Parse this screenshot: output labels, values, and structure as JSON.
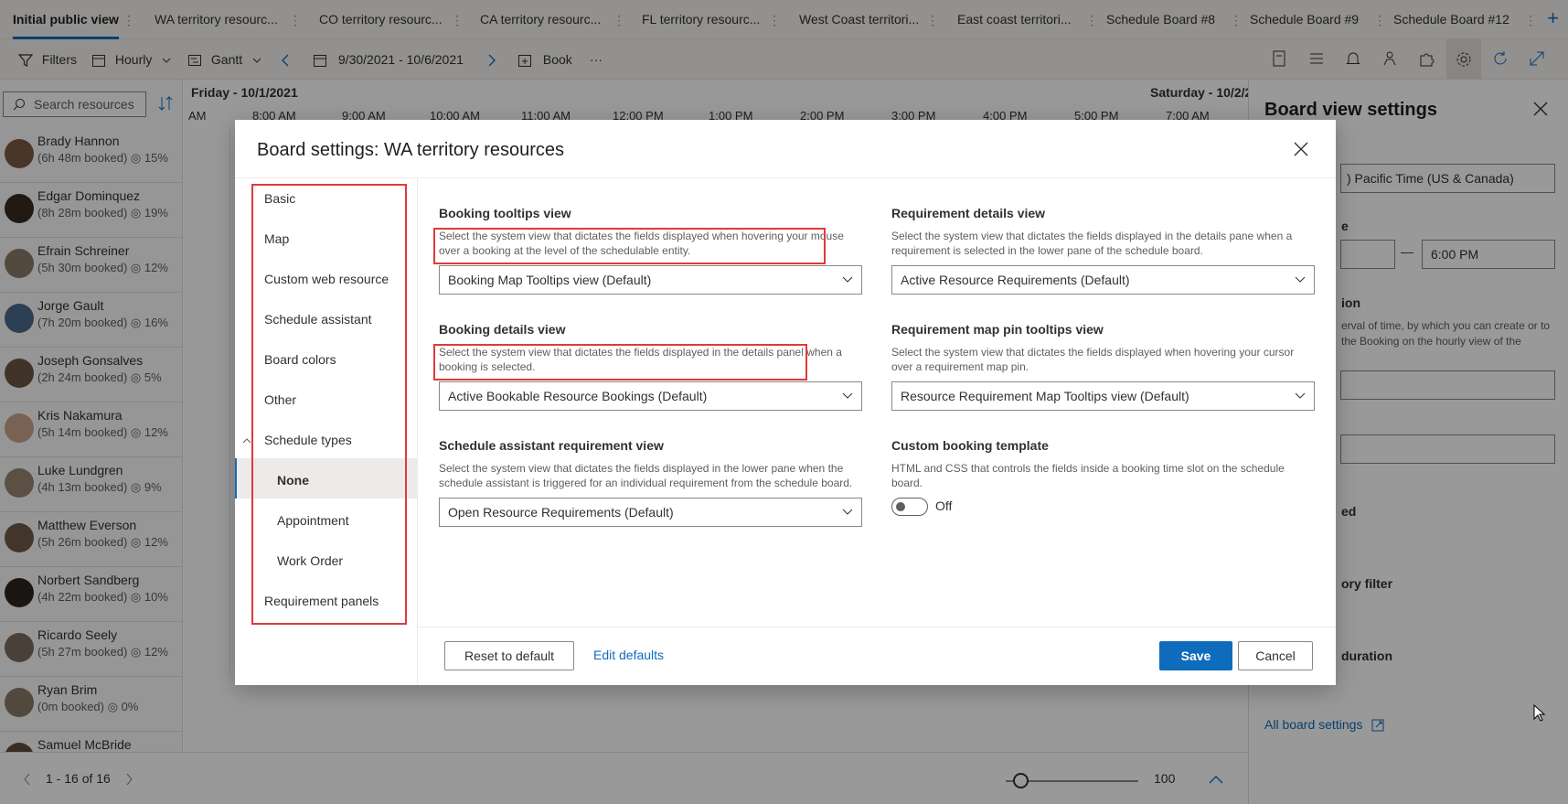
{
  "tabs": [
    {
      "label": "Initial public view"
    },
    {
      "label": "WA territory resourc..."
    },
    {
      "label": "CO territory resourc..."
    },
    {
      "label": "CA territory resourc..."
    },
    {
      "label": "FL territory resourc..."
    },
    {
      "label": "West Coast territori..."
    },
    {
      "label": "East coast territori..."
    },
    {
      "label": "Schedule Board #8"
    },
    {
      "label": "Schedule Board #9"
    },
    {
      "label": "Schedule Board #12"
    }
  ],
  "toolbar": {
    "filters": "Filters",
    "hourly": "Hourly",
    "gantt": "Gantt",
    "date_range": "9/30/2021 - 10/6/2021",
    "book": "Book",
    "more": "···"
  },
  "search": {
    "placeholder": "Search resources"
  },
  "resources": [
    {
      "name": "Brady Hannon",
      "booked": "(6h 48m booked)",
      "pct": "15%",
      "color": "#7a5a44"
    },
    {
      "name": "Edgar Dominquez",
      "booked": "(8h 28m booked)",
      "pct": "19%",
      "color": "#3b2a20"
    },
    {
      "name": "Efrain Schreiner",
      "booked": "(5h 30m booked)",
      "pct": "12%",
      "color": "#8d7b6a"
    },
    {
      "name": "Jorge Gault",
      "booked": "(7h 20m booked)",
      "pct": "16%",
      "color": "#4a6a8a"
    },
    {
      "name": "Joseph Gonsalves",
      "booked": "(2h 24m booked)",
      "pct": "5%",
      "color": "#6b5544"
    },
    {
      "name": "Kris Nakamura",
      "booked": "(5h 14m booked)",
      "pct": "12%",
      "color": "#c7a48a"
    },
    {
      "name": "Luke Lundgren",
      "booked": "(4h 13m booked)",
      "pct": "9%",
      "color": "#9a8674"
    },
    {
      "name": "Matthew Everson",
      "booked": "(5h 26m booked)",
      "pct": "12%",
      "color": "#6e5a4a"
    },
    {
      "name": "Norbert Sandberg",
      "booked": "(4h 22m booked)",
      "pct": "10%",
      "color": "#2f2520"
    },
    {
      "name": "Ricardo Seely",
      "booked": "(5h 27m booked)",
      "pct": "12%",
      "color": "#7d6b5c"
    },
    {
      "name": "Ryan Brim",
      "booked": "(0m booked)",
      "pct": "0%",
      "color": "#8a7866"
    },
    {
      "name": "Samuel McBride",
      "booked": "",
      "pct": "",
      "color": "#5e4c3e"
    }
  ],
  "grid": {
    "day1": "Friday - 10/1/2021",
    "day2": "Saturday - 10/2/2",
    "hours": [
      "AM",
      "8:00 AM",
      "9:00 AM",
      "10:00 AM",
      "11:00 AM",
      "12:00 PM",
      "1:00 PM",
      "2:00 PM",
      "3:00 PM",
      "4:00 PM",
      "5:00 PM",
      "7:00 AM"
    ]
  },
  "pager": {
    "range": "1 - 16 of 16",
    "zoom": "100"
  },
  "side_panel": {
    "title": "Board view settings",
    "timezone": ") Pacific Time (US & Canada)",
    "frag_e": "e",
    "end_time": "6:00 PM",
    "dash": "—",
    "frag_ion": "ion",
    "interval_desc": "erval of time, by which you can create or to the Booking on the hourly view of the",
    "frag_ed": "ed",
    "frag_ory": "ory filter",
    "frag_duration": "duration",
    "all_settings": "All board settings"
  },
  "dialog": {
    "title": "Board settings: WA territory resources",
    "nav": [
      "Basic",
      "Map",
      "Custom web resource",
      "Schedule assistant",
      "Board colors",
      "Other",
      "Schedule types"
    ],
    "nav_sub": [
      "None",
      "Appointment",
      "Work Order"
    ],
    "nav_last": "Requirement panels",
    "fields": {
      "booking_tooltips": {
        "label": "Booking tooltips view",
        "desc": "Select the system view that dictates the fields displayed when hovering your mouse over a booking at the level of the schedulable entity.",
        "value": "Booking Map Tooltips view (Default)"
      },
      "requirement_details": {
        "label": "Requirement details view",
        "desc": "Select the system view that dictates the fields displayed in the details pane when a requirement is selected in the lower pane of the schedule board.",
        "value": "Active Resource Requirements (Default)"
      },
      "booking_details": {
        "label": "Booking details view",
        "desc": "Select the system view that dictates the fields displayed in the details panel when a booking is selected.",
        "value": "Active Bookable Resource Bookings (Default)"
      },
      "requirement_map_pin": {
        "label": "Requirement map pin tooltips view",
        "desc": "Select the system view that dictates the fields displayed when hovering your cursor over a requirement map pin.",
        "value": "Resource Requirement Map Tooltips view (Default)"
      },
      "schedule_assistant": {
        "label": "Schedule assistant requirement view",
        "desc": "Select the system view that dictates the fields displayed in the lower pane when the schedule assistant is triggered for an individual requirement from the schedule board.",
        "value": "Open Resource Requirements (Default)"
      },
      "custom_template": {
        "label": "Custom booking template",
        "desc": "HTML and CSS that controls the fields inside a booking time slot on the schedule board.",
        "toggle_state": "Off"
      }
    },
    "buttons": {
      "reset": "Reset to default",
      "edit_defaults": "Edit defaults",
      "save": "Save",
      "cancel": "Cancel"
    }
  },
  "colors": {
    "accent": "#0f6cbd",
    "highlight": "#e03a3a"
  }
}
